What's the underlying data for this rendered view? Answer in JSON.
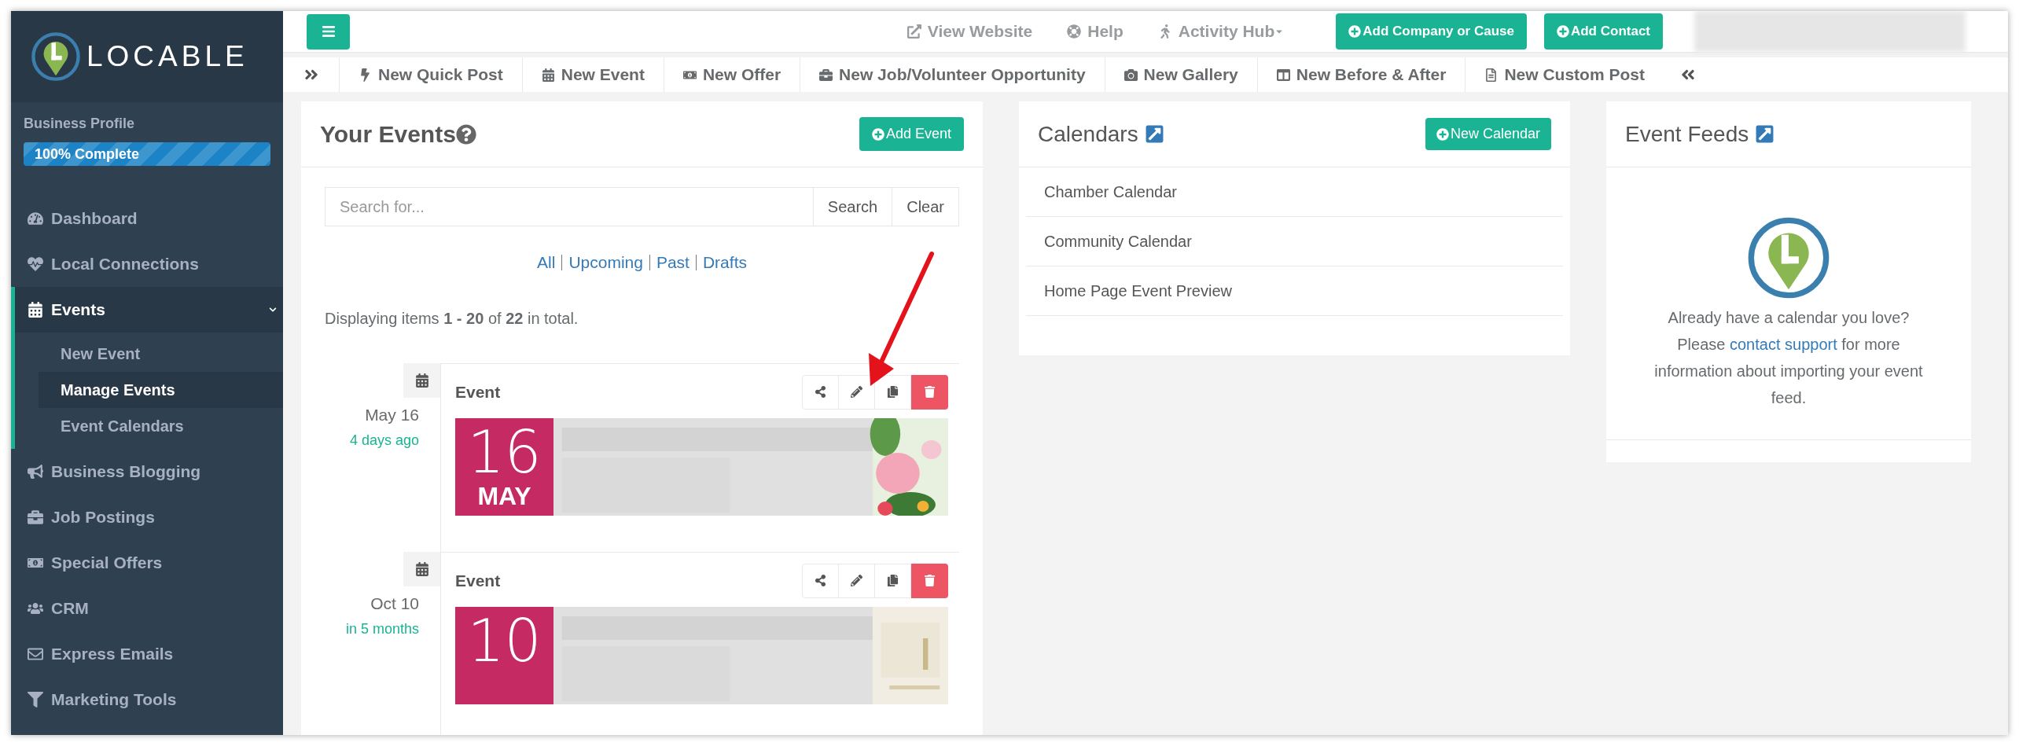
{
  "sidebar": {
    "logo": "LOCABLE",
    "profile": {
      "label": "Business Profile",
      "progress_text": "100% Complete",
      "level": 1
    },
    "items": [
      {
        "label": "Dashboard",
        "selected": false
      },
      {
        "label": "Local Connections",
        "selected": false
      },
      {
        "label": "Events",
        "selected": true,
        "expanded": true,
        "children": [
          {
            "label": "New Event",
            "selected": false
          },
          {
            "label": "Manage Events",
            "selected": true
          },
          {
            "label": "Event Calendars",
            "selected": false
          }
        ]
      },
      {
        "label": "Business Blogging",
        "selected": false
      },
      {
        "label": "Job Postings",
        "selected": false
      },
      {
        "label": "Special Offers",
        "selected": false
      },
      {
        "label": "CRM",
        "selected": false
      },
      {
        "label": "Express Emails",
        "selected": false
      },
      {
        "label": "Marketing Tools",
        "selected": false
      }
    ]
  },
  "topbar": {
    "links": [
      {
        "label": "View Website",
        "dropdown": false
      },
      {
        "label": "Help",
        "dropdown": false
      },
      {
        "label": "Activity Hub",
        "dropdown": true
      }
    ],
    "buttons": [
      "Add Company or Cause",
      "Add Contact"
    ]
  },
  "toolbar": {
    "items": [
      "New Quick Post",
      "New Event",
      "New Offer",
      "New Job/Volunteer Opportunity",
      "New Gallery",
      "New Before & After",
      "New Custom Post"
    ]
  },
  "events_panel": {
    "title": "Your Events",
    "add_button": "Add Event",
    "search": {
      "placeholder": "Search for...",
      "buttons": [
        "Search",
        "Clear"
      ]
    },
    "filters": [
      "All",
      "Upcoming",
      "Past",
      "Drafts"
    ],
    "summary": "Displaying items **1 - 20** of **22** in total.",
    "events": [
      {
        "date": "May 16",
        "relative": "4 days ago",
        "title": "Event",
        "day": "16",
        "month": "MAY"
      },
      {
        "date": "Oct 10",
        "relative": "in 5 months",
        "title": "Event",
        "day": "10"
      }
    ]
  },
  "calendars_panel": {
    "title": "Calendars",
    "button": "New Calendar",
    "items": [
      "Chamber Calendar",
      "Community Calendar",
      "Home Page Event Preview"
    ]
  },
  "feeds_panel": {
    "title": "Event Feeds",
    "message": "Already have a calendar you love? Please",
    "link": "contact support",
    "message_end": "for more information about importing your event feed."
  }
}
